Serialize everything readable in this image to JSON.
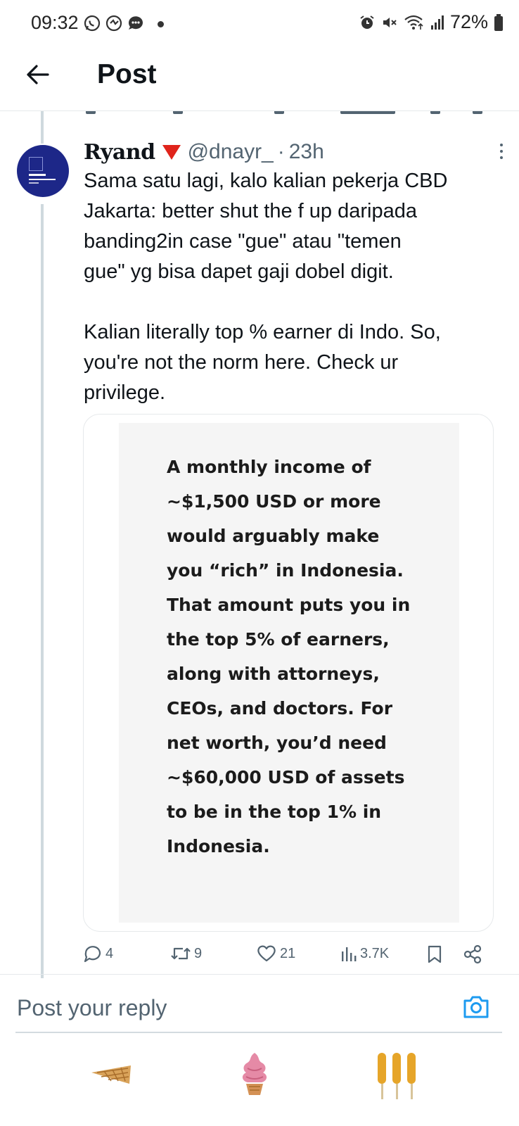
{
  "status_bar": {
    "time": "09:32",
    "battery": "72%",
    "left_icons": [
      "whatsapp-icon",
      "messenger-icon",
      "chat-bubble-icon"
    ],
    "right_icons": [
      "alarm-icon",
      "mute-icon",
      "wifi-icon",
      "signal-icon",
      "battery-icon"
    ]
  },
  "header": {
    "title": "Post"
  },
  "tweet": {
    "author_name": "Ryand",
    "handle": "@dnayr_",
    "separator": "·",
    "time": "23h",
    "paragraphs": [
      "Sama satu lagi, kalo kalian pekerja CBD\nJakarta: better shut the f up daripada\nbanding2in case \"gue\" atau \"temen\ngue\" yg bisa dapet gaji dobel digit.",
      "Kalian literally top % earner di Indo. So,\nyou're not the norm here. Check ur\nprivilege."
    ],
    "media_text": "A monthly income of ~$1,500 USD or more would arguably make you “rich” in Indonesia. That amount puts you in the top 5% of earners, along with attorneys, CEOs, and doctors. For net worth, you’d need ~$60,000 USD of assets to be in the top 1% in Indonesia.",
    "actions": {
      "replies": "4",
      "reposts": "9",
      "likes": "21",
      "views": "3.7K"
    }
  },
  "reply_box": {
    "placeholder": "Post your reply"
  },
  "keyboard_suggestions": [
    "ice-cream-cone-sticker",
    "soft-serve-sticker",
    "corn-dog-sticker"
  ],
  "colors": {
    "text_primary": "#0f1419",
    "text_secondary": "#536471",
    "accent_blue": "#1d9bf0",
    "badge_red": "#e0241b",
    "avatar_blue": "#1d2788"
  }
}
